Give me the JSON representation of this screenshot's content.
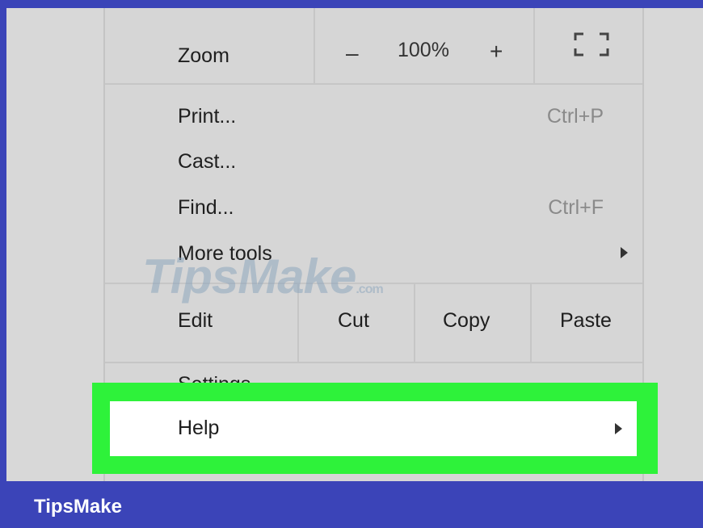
{
  "menu": {
    "zoom": {
      "label": "Zoom",
      "minus": "–",
      "value": "100%",
      "plus": "+"
    },
    "print": {
      "label": "Print...",
      "shortcut": "Ctrl+P"
    },
    "cast": {
      "label": "Cast..."
    },
    "find": {
      "label": "Find...",
      "shortcut": "Ctrl+F"
    },
    "more_tools": {
      "label": "More tools"
    },
    "edit": {
      "label": "Edit",
      "cut": "Cut",
      "copy": "Copy",
      "paste": "Paste"
    },
    "settings": {
      "label": "Settings"
    },
    "help": {
      "label": "Help"
    }
  },
  "watermark": {
    "brand": "TipsMake",
    "suffix": ".com"
  },
  "footer": {
    "brand": "TipsMake"
  },
  "colors": {
    "highlight": "#2ef23a",
    "frame": "#3b44b8",
    "menu_bg": "#d6d6d6"
  }
}
